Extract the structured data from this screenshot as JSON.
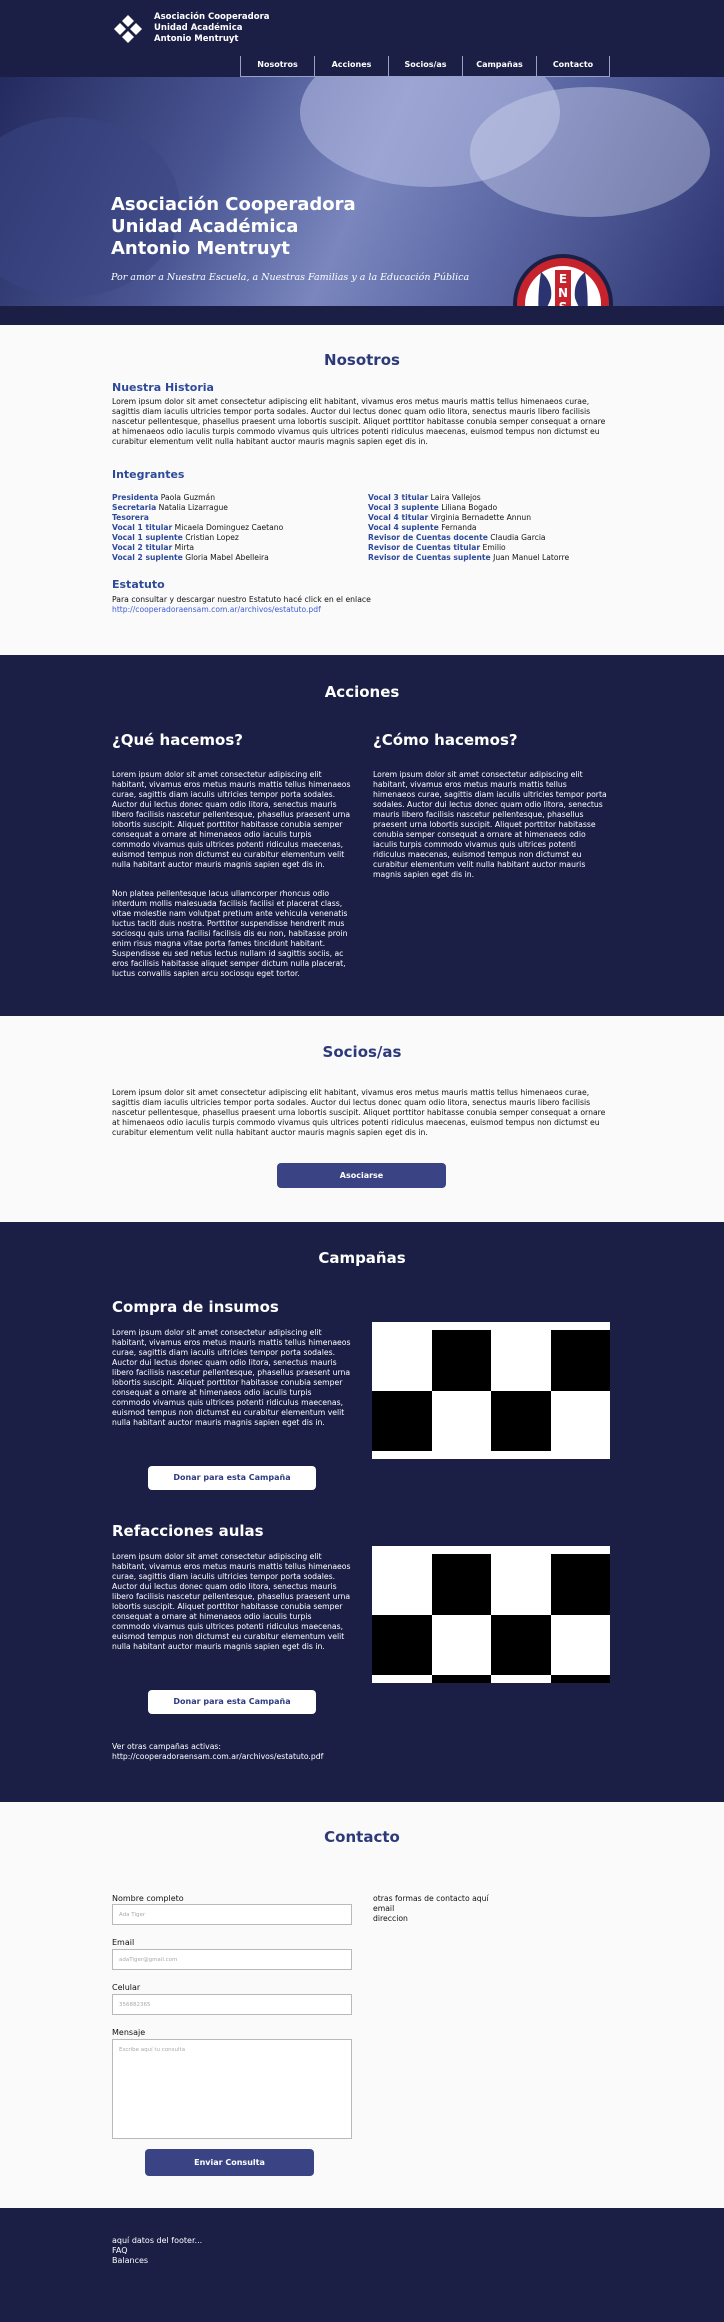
{
  "header": {
    "logo_lines": [
      "Asociación Cooperadora",
      "Unidad Académica",
      "Antonio Mentruyt"
    ],
    "nav": [
      "Nosotros",
      "Acciones",
      "Socios/as",
      "Campañas",
      "Contacto"
    ]
  },
  "hero": {
    "title_lines": [
      "Asociación Cooperadora",
      "Unidad Académica",
      "Antonio Mentruyt"
    ],
    "subtitle": "Por amor a Nuestra Escuela, a Nuestras Familias y a la Educación Pública",
    "badge_text": "ENSAM"
  },
  "nosotros": {
    "title": "Nosotros",
    "historia_title": "Nuestra Historia",
    "historia_text": "Lorem ipsum dolor sit amet consectetur adipiscing elit habitant, vivamus eros metus mauris mattis tellus himenaeos curae, sagittis diam iaculis ultricies tempor porta sodales. Auctor dui lectus donec quam odio litora, senectus mauris libero facilisis nascetur pellentesque, phasellus praesent urna lobortis suscipit. Aliquet porttitor habitasse conubia semper consequat a ornare at himenaeos odio iaculis turpis commodo vivamus quis ultrices potenti ridiculus maecenas, euismod tempus non dictumst eu curabitur elementum velit nulla habitant auctor mauris magnis sapien eget dis in.",
    "integrantes_title": "Integrantes",
    "integrantes_left": [
      {
        "role": "Presidenta",
        "name": "Paola Guzmán"
      },
      {
        "role": "Secretaria",
        "name": "Natalia  Lizarrague"
      },
      {
        "role": "Tesorera",
        "name": ""
      },
      {
        "role": "Vocal 1 titular",
        "name": "Micaela Dominguez Caetano"
      },
      {
        "role": "Vocal 1 suplente",
        "name": "Cristian Lopez"
      },
      {
        "role": "Vocal 2 titular",
        "name": "Mirta"
      },
      {
        "role": "Vocal 2 suplente",
        "name": "Gloria Mabel Abelleira"
      }
    ],
    "integrantes_right": [
      {
        "role": "Vocal 3 titular",
        "name": "Laira Vallejos"
      },
      {
        "role": "Vocal 3 suplente",
        "name": "Liliana Bogado"
      },
      {
        "role": "Vocal 4 titular",
        "name": "Virginia Bernadette Annun"
      },
      {
        "role": "Vocal 4 suplente",
        "name": "Fernanda"
      },
      {
        "role": "Revisor de Cuentas docente",
        "name": "Claudia Garcia"
      },
      {
        "role": "Revisor de Cuentas titular",
        "name": "Emilio"
      },
      {
        "role": "Revisor de Cuentas suplente",
        "name": "Juan Manuel Latorre"
      }
    ],
    "estatuto_title": "Estatuto",
    "estatuto_text": "Para consultar y descargar nuestro Estatuto hacé click en el enlace",
    "estatuto_link": "http://cooperadoraensam.com.ar/archivos/estatuto.pdf"
  },
  "acciones": {
    "title": "Acciones",
    "que_title": "¿Qué hacemos?",
    "que_p1": "Lorem ipsum dolor sit amet consectetur adipiscing elit habitant, vivamus eros metus mauris mattis tellus himenaeos curae, sagittis diam iaculis ultricies tempor porta sodales. Auctor dui lectus donec quam odio litora, senectus mauris libero facilisis nascetur pellentesque, phasellus praesent urna lobortis suscipit. Aliquet porttitor habitasse conubia semper consequat a ornare at himenaeos odio iaculis turpis commodo vivamus quis ultrices potenti ridiculus maecenas, euismod tempus non dictumst eu curabitur elementum velit nulla habitant auctor mauris magnis sapien eget dis in.",
    "que_p2": "Non platea pellentesque lacus ullamcorper rhoncus odio interdum mollis malesuada facilisis facilisi et placerat class, vitae molestie nam volutpat pretium ante vehicula venenatis luctus taciti duis nostra. Porttitor suspendisse hendrerit mus sociosqu quis urna facilisi facilisis dis eu non, habitasse proin enim risus magna vitae porta fames tincidunt habitant. Suspendisse eu sed netus lectus nullam id sagittis sociis, ac eros facilisis habitasse aliquet semper dictum nulla placerat, luctus convallis sapien arcu sociosqu eget tortor.",
    "como_title": "¿Cómo hacemos?",
    "como_p1": "Lorem ipsum dolor sit amet consectetur adipiscing elit habitant, vivamus eros metus mauris mattis tellus himenaeos curae, sagittis diam iaculis ultricies tempor porta sodales. Auctor dui lectus donec quam odio litora, senectus mauris libero facilisis nascetur pellentesque, phasellus praesent urna lobortis suscipit. Aliquet porttitor habitasse conubia semper consequat a ornare at himenaeos odio iaculis turpis commodo vivamus quis ultrices potenti ridiculus maecenas, euismod tempus non dictumst eu curabitur elementum velit nulla habitant auctor mauris magnis sapien eget dis in."
  },
  "socios": {
    "title": "Socios/as",
    "text": "Lorem ipsum dolor sit amet consectetur adipiscing elit habitant, vivamus eros metus mauris mattis tellus himenaeos curae, sagittis diam iaculis ultricies tempor porta sodales. Auctor dui lectus donec quam odio litora, senectus mauris libero facilisis nascetur pellentesque, phasellus praesent urna lobortis suscipit. Aliquet porttitor habitasse conubia semper consequat a ornare at himenaeos odio iaculis turpis commodo vivamus quis ultrices potenti ridiculus maecenas, euismod tempus non dictumst eu curabitur elementum velit nulla habitant auctor mauris magnis sapien eget dis in.",
    "button": "Asociarse"
  },
  "campanas": {
    "title": "Campañas",
    "items": [
      {
        "title": "Compra de insumos",
        "text": "Lorem ipsum dolor sit amet consectetur adipiscing elit habitant, vivamus eros metus mauris mattis tellus himenaeos curae, sagittis diam iaculis ultricies tempor porta sodales. Auctor dui lectus donec quam odio litora, senectus mauris libero facilisis nascetur pellentesque, phasellus praesent urna lobortis suscipit. Aliquet porttitor habitasse conubia semper consequat a ornare at himenaeos odio iaculis turpis commodo vivamus quis ultrices potenti ridiculus maecenas, euismod tempus non dictumst eu curabitur elementum velit nulla habitant auctor mauris magnis sapien eget dis in.",
        "button": "Donar para esta Campaña"
      },
      {
        "title": "Refacciones aulas",
        "text": "Lorem ipsum dolor sit amet consectetur adipiscing elit habitant, vivamus eros metus mauris mattis tellus himenaeos curae, sagittis diam iaculis ultricies tempor porta sodales. Auctor dui lectus donec quam odio litora, senectus mauris libero facilisis nascetur pellentesque, phasellus praesent urna lobortis suscipit. Aliquet porttitor habitasse conubia semper consequat a ornare at himenaeos odio iaculis turpis commodo vivamus quis ultrices potenti ridiculus maecenas, euismod tempus non dictumst eu curabitur elementum velit nulla habitant auctor mauris magnis sapien eget dis in.",
        "button": "Donar para esta Campaña"
      }
    ],
    "other_label": "Ver otras campañas activas:",
    "other_link": "http://cooperadoraensam.com.ar/archivos/estatuto.pdf"
  },
  "contacto": {
    "title": "Contacto",
    "name_label": "Nombre completo",
    "name_placeholder": "Ada Tiger",
    "email_label": "Email",
    "email_placeholder": "adaTiger@gmail.com",
    "phone_label": "Celular",
    "phone_placeholder": "356882365",
    "message_label": "Mensaje",
    "message_placeholder": "Escribe aquí tu consulta",
    "submit": "Enviar Consulta",
    "other_lines": [
      "otras formas de contacto aquí",
      "email",
      "direccion"
    ]
  },
  "footer": {
    "lines": [
      "aquí datos del footer...",
      "FAQ",
      "Balances"
    ]
  },
  "colors": {
    "navy": "#1c1f45",
    "accent_blue": "#2e4a9a",
    "button_blue": "#3a4485",
    "badge_red": "#c7232c"
  }
}
